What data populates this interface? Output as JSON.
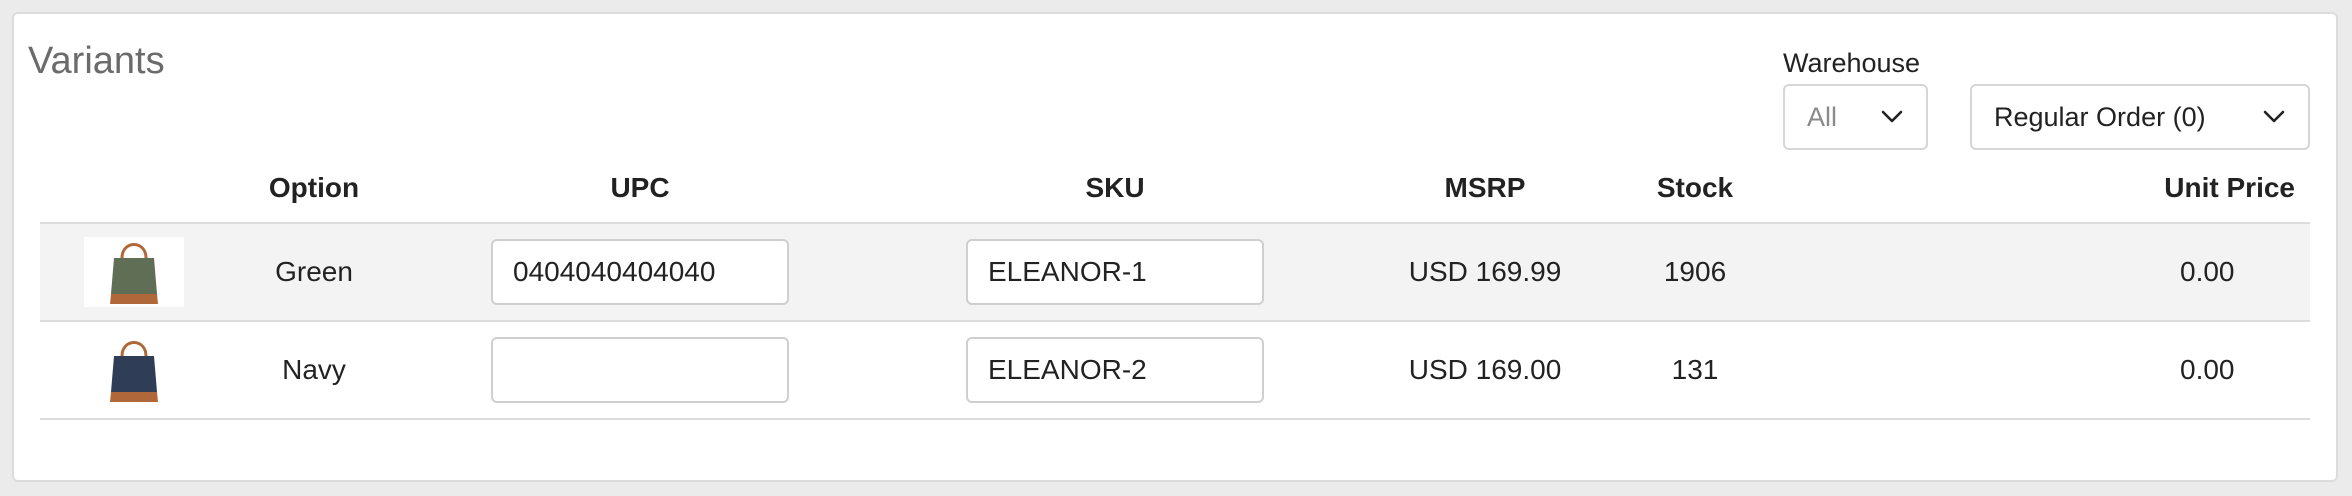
{
  "section_title": "Variants",
  "warehouse": {
    "label": "Warehouse",
    "selected": "All"
  },
  "order_type": {
    "selected": "Regular Order (0)"
  },
  "columns": {
    "option": "Option",
    "upc": "UPC",
    "sku": "SKU",
    "msrp": "MSRP",
    "stock": "Stock",
    "unit_price": "Unit Price"
  },
  "rows": [
    {
      "image": "green-tote-bag",
      "option": "Green",
      "upc": "0404040404040",
      "sku": "ELEANOR-1",
      "msrp": "USD 169.99",
      "stock": "1906",
      "unit_price": "0.00"
    },
    {
      "image": "navy-tote-bag",
      "option": "Navy",
      "upc": "",
      "sku": "ELEANOR-2",
      "msrp": "USD 169.00",
      "stock": "131",
      "unit_price": "0.00"
    }
  ],
  "colors": {
    "green_bag": "#5f6e55",
    "navy_bag": "#2f3d57",
    "leather": "#b0683a"
  }
}
